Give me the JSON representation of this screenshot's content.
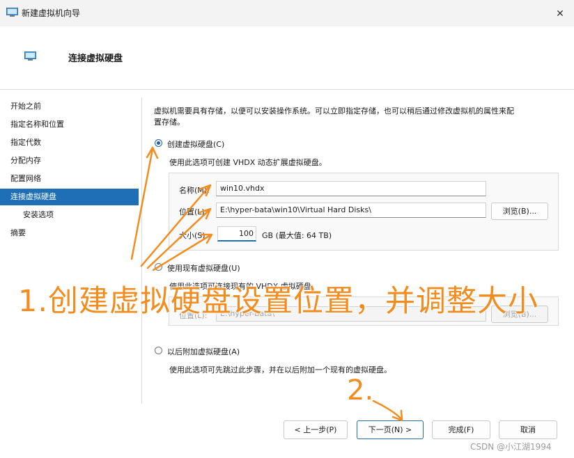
{
  "window": {
    "title": "新建虚拟机向导",
    "close_glyph": "✕"
  },
  "header": {
    "title": "连接虚拟硬盘"
  },
  "nav": {
    "items": [
      {
        "label": "开始之前"
      },
      {
        "label": "指定名称和位置"
      },
      {
        "label": "指定代数"
      },
      {
        "label": "分配内存"
      },
      {
        "label": "配置网络"
      },
      {
        "label": "连接虚拟硬盘",
        "active": true
      },
      {
        "label": "安装选项",
        "sub": true
      },
      {
        "label": "摘要"
      }
    ]
  },
  "content": {
    "intro_line1": "虚拟机需要具有存储，以便可以安装操作系统。可以立即指定存储，也可以稍后通过修改虚拟机的属性来配",
    "intro_line2": "置存储。",
    "create": {
      "label": "创建虚拟硬盘(C)",
      "desc": "使用此选项可创建 VHDX 动态扩展虚拟硬盘。",
      "name_label": "名称(M):",
      "name_value": "win10.vhdx",
      "location_label": "位置(L):",
      "location_value": "E:\\hyper-bata\\win10\\Virtual Hard Disks\\",
      "browse_label": "浏览(B)...",
      "size_label": "大小(S):",
      "size_value": "100",
      "size_unit": "GB (最大值: 64 TB)"
    },
    "existing": {
      "label": "使用现有虚拟硬盘(U)",
      "desc": "使用此选项可连接现有的 VHDX 虚拟硬盘。",
      "location_label": "位置(L):",
      "location_value": "E:\\hyper-Bata\\",
      "browse_label": "浏览(B)..."
    },
    "later": {
      "label": "以后附加虚拟硬盘(A)",
      "desc": "使用此选项可先跳过此步骤，并在以后附加一个现有的虚拟硬盘。"
    }
  },
  "footer": {
    "prev_label": "< 上一步(P)",
    "next_label": "下一页(N) >",
    "finish_label": "完成(F)",
    "cancel_label": "取消"
  },
  "annotations": {
    "step1": "1.创建虚拟硬盘设置位置，并调整大小",
    "step2": "2."
  },
  "watermark": "CSDN @小江湖1994",
  "colors": {
    "accent": "#1e6fb5",
    "annotation": "#f28c1e"
  }
}
